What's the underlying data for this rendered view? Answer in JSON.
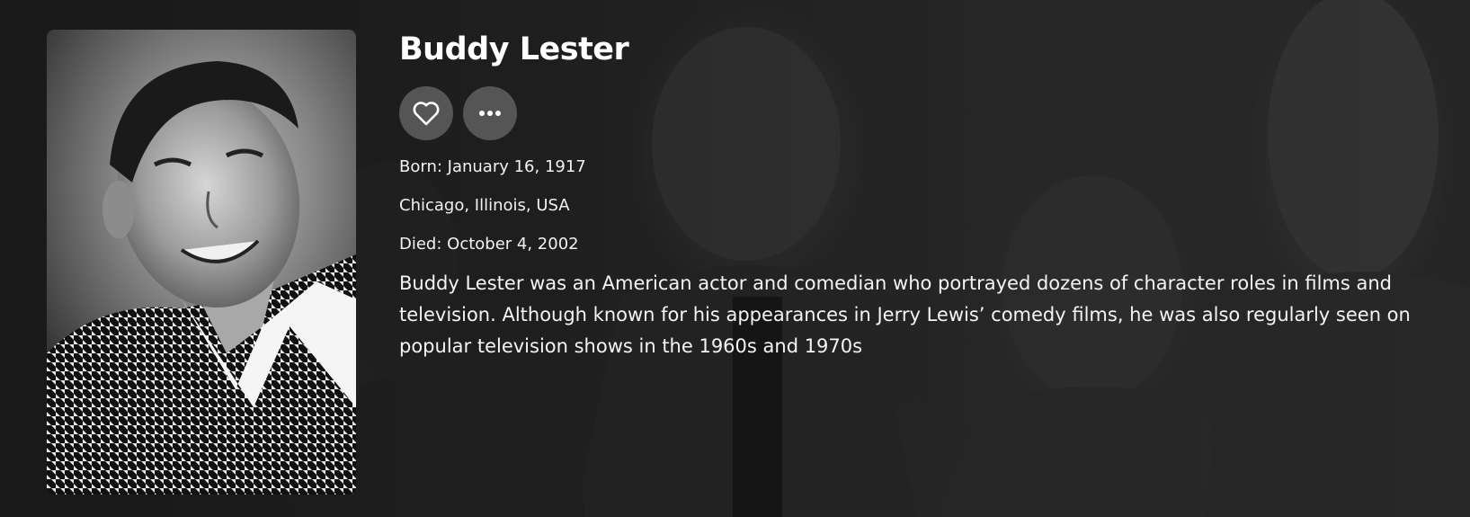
{
  "person": {
    "name": "Buddy Lester",
    "born": "Born: January 16, 1917",
    "birthplace": "Chicago, Illinois, USA",
    "died": "Died: October 4, 2002",
    "bio": "Buddy Lester was an American actor and comedian who portrayed dozens of character roles in films and television. Although known for his appearances in Jerry Lewis’ comedy films, he was also regularly seen on popular television shows in the 1960s and 1970s"
  },
  "actions": {
    "favorite_icon": "heart-icon",
    "more_icon": "more-horizontal-icon"
  },
  "colors": {
    "background": "#1c1c1c",
    "button_bg": "#5f5f5f",
    "text": "#ffffff"
  }
}
